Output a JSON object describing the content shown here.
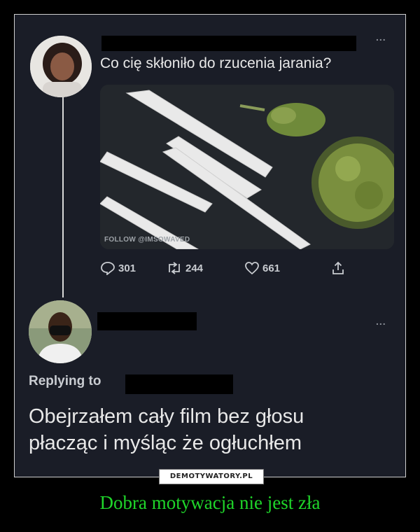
{
  "tweet": {
    "question": "Co cię skłoniło do rzucenia jarania?",
    "menu": "...",
    "watermark": "FOLLOW @IMSOWAVED",
    "stats": {
      "replies": "301",
      "retweets": "244",
      "likes": "661"
    }
  },
  "reply": {
    "menu": "...",
    "replying_to": "Replying to",
    "text_line1": "Obejrzałem cały film bez głosu",
    "text_line2": "płacząc i myśląc że ogłuchłem"
  },
  "logo": "DEMOTYWATORY.PL",
  "caption": "Dobra motywacja nie jest zła",
  "colors": {
    "background": "#1a1d27",
    "caption": "#1fd62a",
    "redaction": "#000000"
  }
}
